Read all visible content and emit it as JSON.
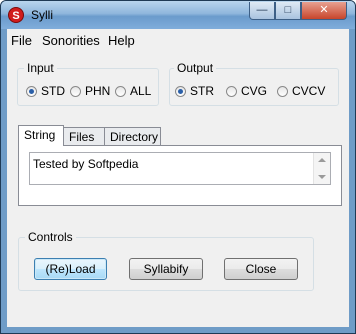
{
  "window": {
    "title": "Sylli",
    "icon": "syllable-logo-icon"
  },
  "menu": [
    "File",
    "Sonorities",
    "Help"
  ],
  "input_group": {
    "title": "Input",
    "options": [
      {
        "label": "STD",
        "checked": true
      },
      {
        "label": "PHN",
        "checked": false
      },
      {
        "label": "ALL",
        "checked": false
      }
    ]
  },
  "output_group": {
    "title": "Output",
    "options": [
      {
        "label": "STR",
        "checked": true
      },
      {
        "label": "CVG",
        "checked": false
      },
      {
        "label": "CVCV",
        "checked": false
      }
    ]
  },
  "tabs": [
    {
      "label": "String",
      "active": true
    },
    {
      "label": "Files",
      "active": false
    },
    {
      "label": "Directory",
      "active": false
    }
  ],
  "string_textbox": {
    "value": "Tested by Softpedia"
  },
  "controls": {
    "title": "Controls",
    "reload_label": "(Re)Load",
    "syllabify_label": "Syllabify",
    "close_label": "Close"
  },
  "colors": {
    "titlebar": "#8fb6dc",
    "client_bg": "#f0f0f0",
    "close_button": "#c7452b",
    "radio_dot": "#2a5fa8"
  }
}
